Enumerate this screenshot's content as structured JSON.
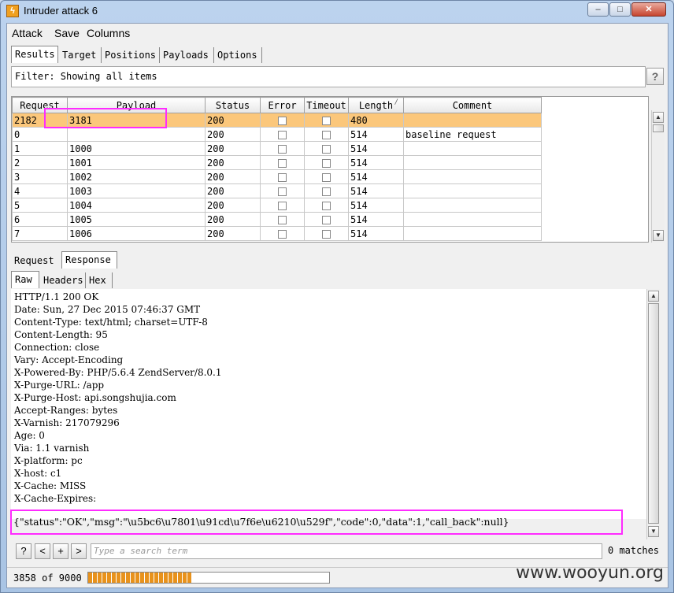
{
  "window": {
    "title": "Intruder attack 6",
    "controls": {
      "minimize": "–",
      "maximize": "□",
      "close": "✕"
    }
  },
  "menu": [
    "Attack",
    "Save",
    "Columns"
  ],
  "tabs": [
    "Results",
    "Target",
    "Positions",
    "Payloads",
    "Options"
  ],
  "filter": {
    "text": "Filter: Showing all items",
    "help": "?"
  },
  "table": {
    "columns": [
      "Request",
      "Payload",
      "Status",
      "Error",
      "Timeout",
      "Length",
      "Comment"
    ],
    "sort_indicator": "/",
    "rows": [
      {
        "request": "2182",
        "payload": "3181",
        "status": "200",
        "length": "480",
        "comment": "",
        "selected": true
      },
      {
        "request": "0",
        "payload": "",
        "status": "200",
        "length": "514",
        "comment": "baseline request"
      },
      {
        "request": "1",
        "payload": "1000",
        "status": "200",
        "length": "514",
        "comment": ""
      },
      {
        "request": "2",
        "payload": "1001",
        "status": "200",
        "length": "514",
        "comment": ""
      },
      {
        "request": "3",
        "payload": "1002",
        "status": "200",
        "length": "514",
        "comment": ""
      },
      {
        "request": "4",
        "payload": "1003",
        "status": "200",
        "length": "514",
        "comment": ""
      },
      {
        "request": "5",
        "payload": "1004",
        "status": "200",
        "length": "514",
        "comment": ""
      },
      {
        "request": "6",
        "payload": "1005",
        "status": "200",
        "length": "514",
        "comment": ""
      },
      {
        "request": "7",
        "payload": "1006",
        "status": "200",
        "length": "514",
        "comment": ""
      }
    ]
  },
  "detail_tabs": [
    "Request",
    "Response"
  ],
  "view_tabs": [
    "Raw",
    "Headers",
    "Hex"
  ],
  "response": {
    "headers": [
      "HTTP/1.1 200 OK",
      "Date: Sun, 27 Dec 2015 07:46:37 GMT",
      "Content-Type: text/html; charset=UTF-8",
      "Content-Length: 95",
      "Connection: close",
      "Vary: Accept-Encoding",
      "X-Powered-By: PHP/5.6.4 ZendServer/8.0.1",
      "X-Purge-URL: /app",
      "X-Purge-Host: api.songshujia.com",
      "Accept-Ranges: bytes",
      "X-Varnish: 217079296",
      "Age: 0",
      "Via: 1.1 varnish",
      "X-platform: pc",
      "X-host: c1",
      "X-Cache: MISS",
      "X-Cache-Expires:"
    ],
    "body": "{\"status\":\"OK\",\"msg\":\"\\u5bc6\\u7801\\u91cd\\u7f6e\\u6210\\u529f\",\"code\":0,\"data\":1,\"call_back\":null}"
  },
  "search": {
    "buttons": [
      "?",
      "<",
      "+",
      ">"
    ],
    "placeholder": "Type a search term",
    "matches": "0 matches"
  },
  "progress": {
    "label": "3858 of 9000",
    "done": 3858,
    "total": 9000
  },
  "watermark": "www.wooyun.org",
  "colors": {
    "selected_row": "#fbc77b",
    "highlight": "#ff2bff",
    "progress": "#e8921c"
  }
}
